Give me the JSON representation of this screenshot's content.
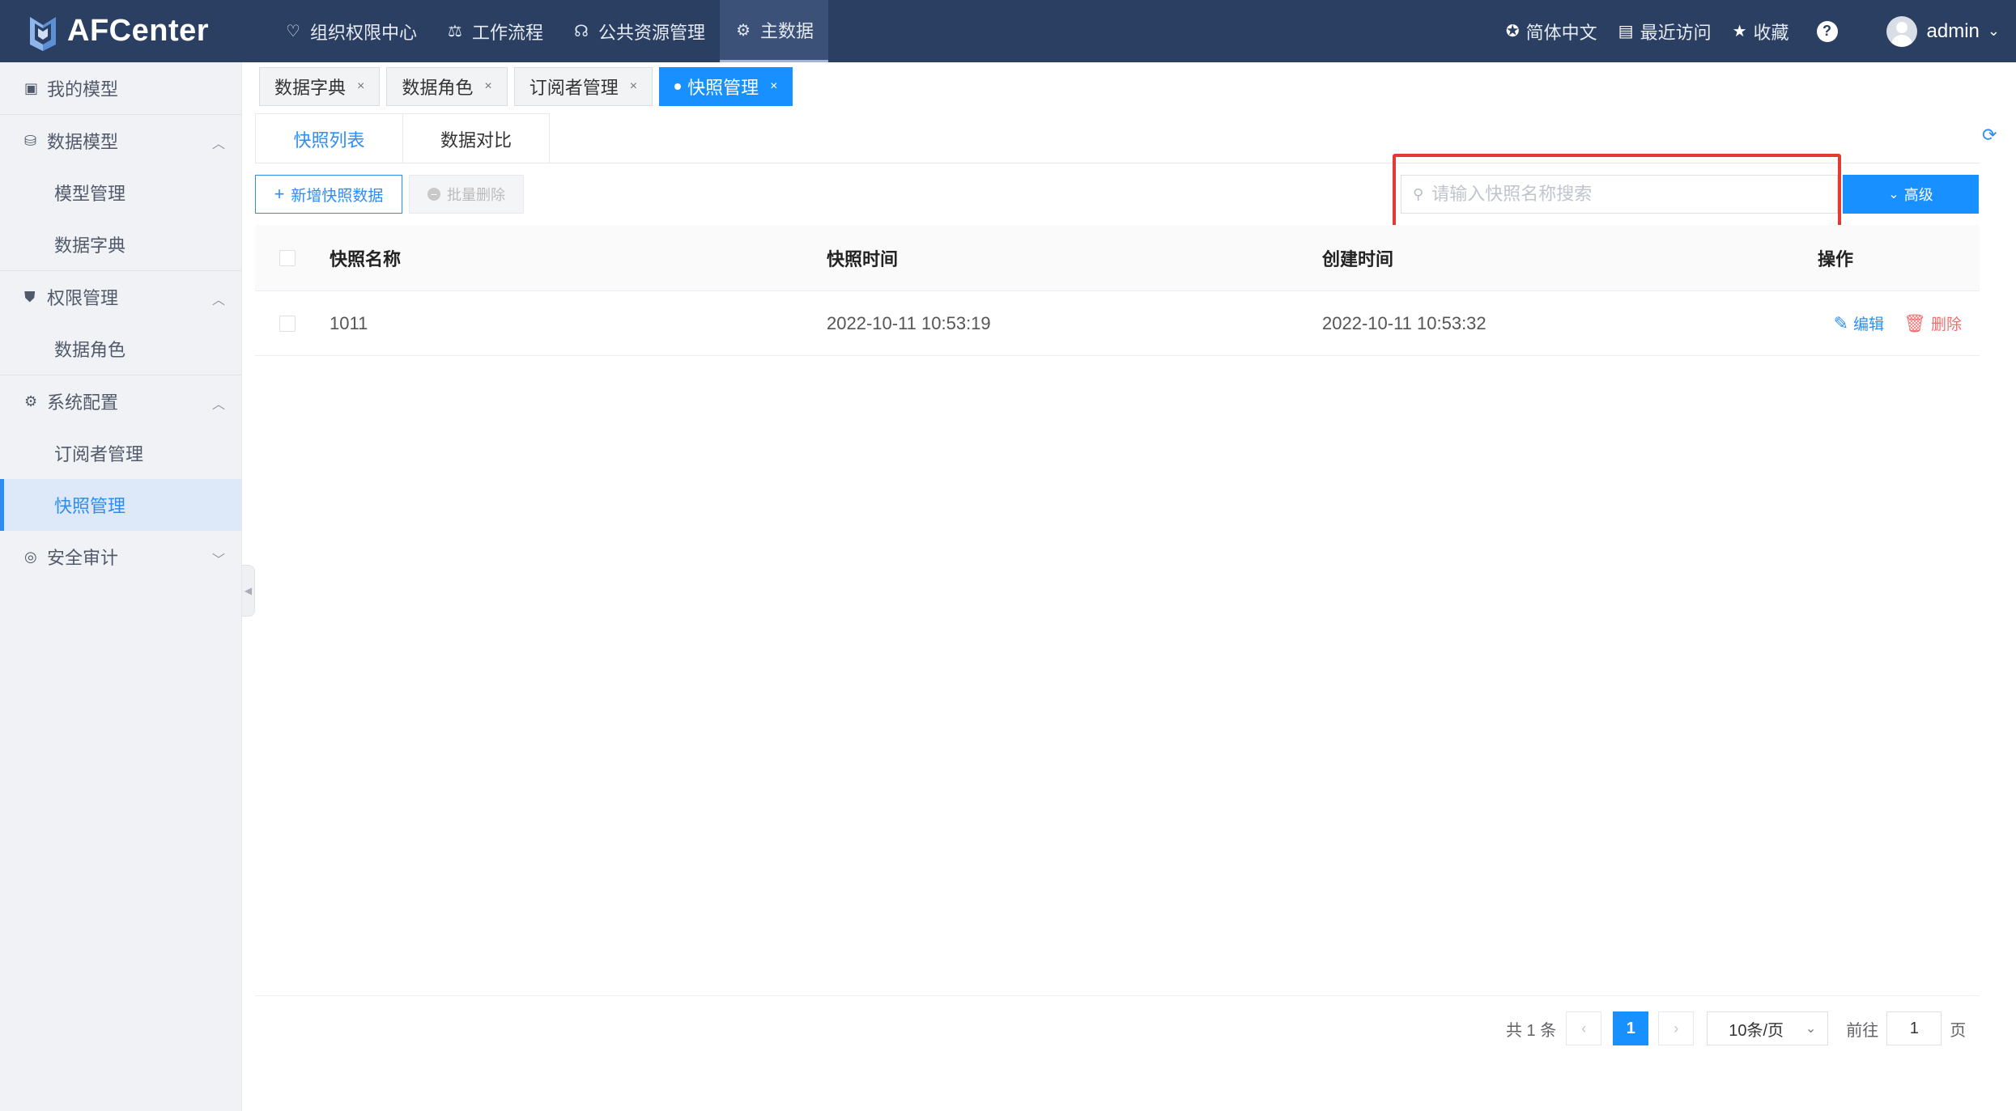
{
  "app": {
    "logo_text": "AFCenter"
  },
  "topnav": [
    {
      "label": "组织权限中心",
      "icon": "shield-heart-icon"
    },
    {
      "label": "工作流程",
      "icon": "scale-icon"
    },
    {
      "label": "公共资源管理",
      "icon": "people-icon"
    },
    {
      "label": "主数据",
      "icon": "sliders-icon",
      "active": true
    }
  ],
  "topright": {
    "language": "简体中文",
    "recent": "最近访问",
    "favorites": "收藏",
    "help": "?",
    "user": "admin"
  },
  "sidebar": {
    "items": [
      {
        "label": "我的模型",
        "icon": "wallet-icon"
      },
      {
        "label": "数据模型",
        "icon": "database-icon",
        "expanded": true
      },
      {
        "label": "模型管理",
        "sub": true
      },
      {
        "label": "数据字典",
        "sub": true
      },
      {
        "label": "权限管理",
        "icon": "shield-icon",
        "expanded": true
      },
      {
        "label": "数据角色",
        "sub": true
      },
      {
        "label": "系统配置",
        "icon": "gear-icon",
        "expanded": true
      },
      {
        "label": "订阅者管理",
        "sub": true
      },
      {
        "label": "快照管理",
        "sub": true,
        "active": true
      },
      {
        "label": "安全审计",
        "icon": "shield-check-icon",
        "expanded": false
      }
    ]
  },
  "page_tabs": [
    {
      "label": "数据字典"
    },
    {
      "label": "数据角色"
    },
    {
      "label": "订阅者管理"
    },
    {
      "label": "快照管理",
      "active": true
    }
  ],
  "sub_tabs": [
    {
      "label": "快照列表",
      "active": true
    },
    {
      "label": "数据对比"
    }
  ],
  "toolbar": {
    "add_label": "新增快照数据",
    "batch_delete_label": "批量删除",
    "search_placeholder": "请输入快照名称搜索",
    "advanced_label": "高级"
  },
  "table": {
    "headers": [
      "快照名称",
      "快照时间",
      "创建时间",
      "操作"
    ],
    "rows": [
      {
        "name": "1011",
        "snapshot_time": "2022-10-11 10:53:19",
        "created_time": "2022-10-11 10:53:32"
      }
    ],
    "actions": {
      "edit": "编辑",
      "delete": "删除"
    }
  },
  "pagination": {
    "total_text": "共 1 条",
    "current_page": "1",
    "page_size": "10条/页",
    "goto_label": "前往",
    "goto_value": "1",
    "page_suffix": "页"
  },
  "colors": {
    "header_bg": "#2b3f62",
    "accent": "#1890ff",
    "danger": "#f56c6c",
    "highlight": "#e53935"
  }
}
